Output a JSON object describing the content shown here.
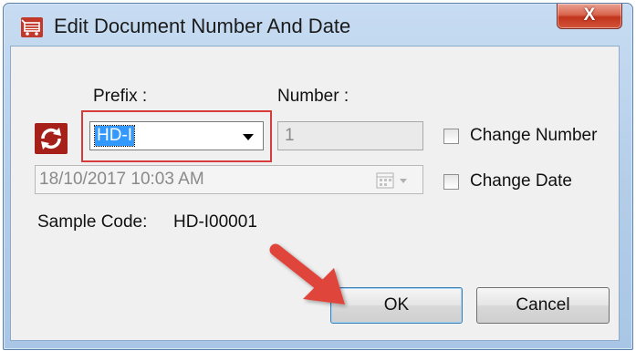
{
  "window": {
    "title": "Edit Document Number And Date",
    "close_glyph": "X",
    "icon": "shopping-cart-icon"
  },
  "form": {
    "prefix_label": "Prefix :",
    "prefix_value": "HD-I",
    "number_label": "Number :",
    "number_value": "1",
    "change_number_label": "Change Number",
    "change_number_checked": false,
    "date_value": "18/10/2017 10:03 AM",
    "change_date_label": "Change Date",
    "change_date_checked": false,
    "sample_code_label": "Sample Code:",
    "sample_code_value": "HD-I00001",
    "refresh_icon": "refresh-icon",
    "calendar_icon": "calendar-dropdown-icon"
  },
  "buttons": {
    "ok_label": "OK",
    "cancel_label": "Cancel"
  },
  "colors": {
    "highlight_border": "#d63c3c",
    "selection": "#3399ff",
    "annotation_arrow": "#e0453a"
  }
}
